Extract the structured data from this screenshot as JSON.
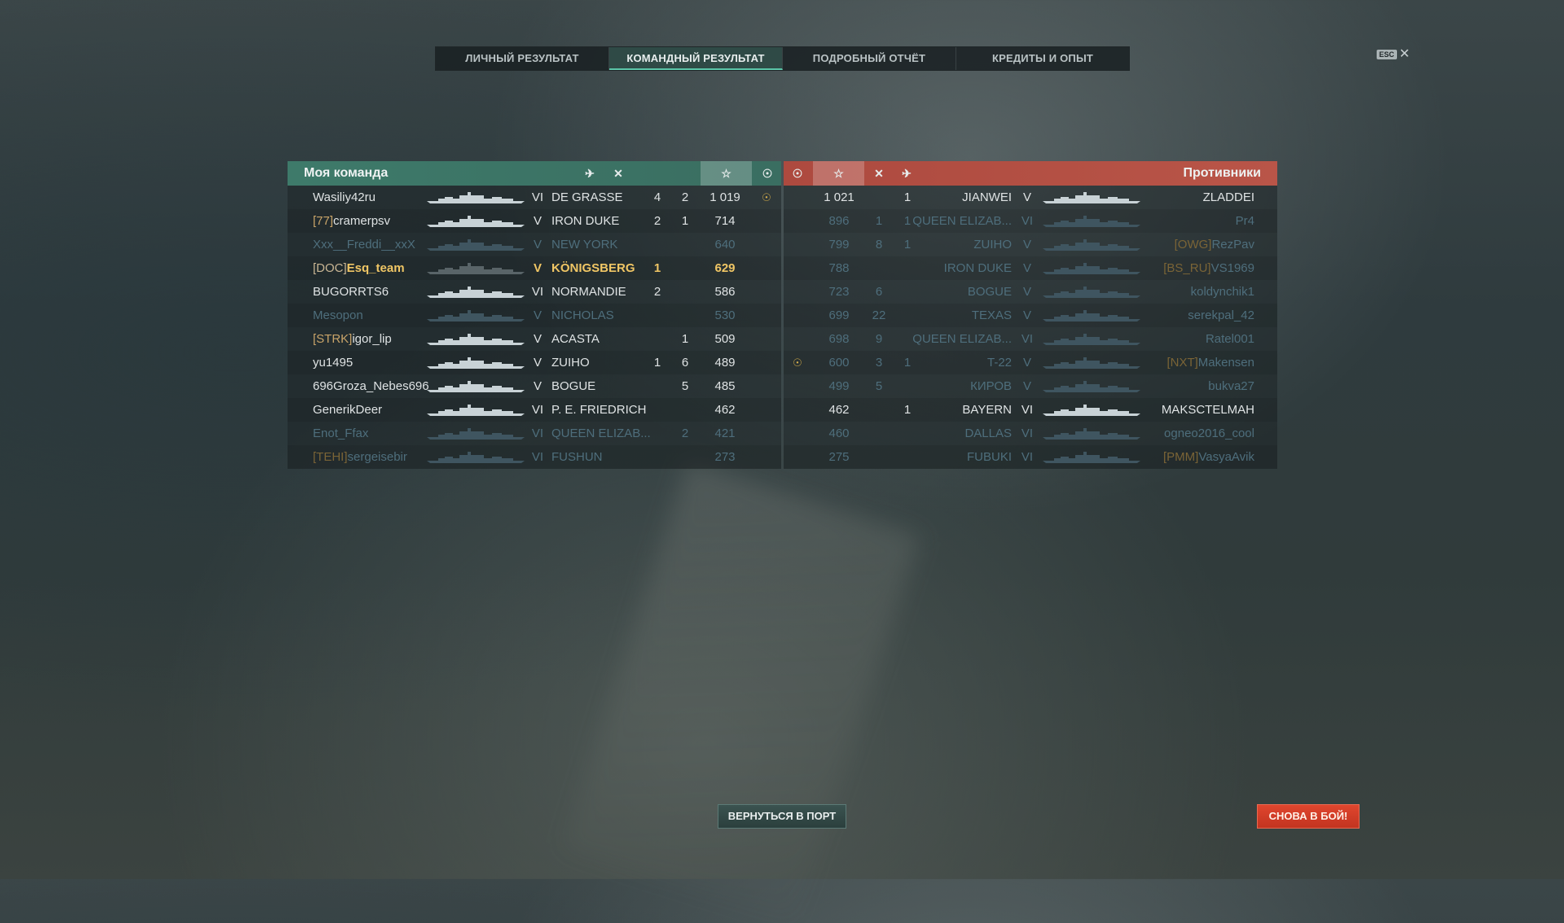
{
  "tabs": [
    "ЛИЧНЫЙ РЕЗУЛЬТАТ",
    "КОМАНДНЫЙ РЕЗУЛЬТАТ",
    "ПОДРОБНЫЙ ОТЧЁТ",
    "КРЕДИТЫ И ОПЫТ"
  ],
  "active_tab": 1,
  "esc_label": "ESC",
  "close_symbol": "✕",
  "header_icons": {
    "planes": "✈",
    "frags": "✕",
    "score": "☆",
    "base": "☉"
  },
  "my_team": {
    "title": "Моя команда",
    "rows": [
      {
        "clan": "",
        "player": "Wasiliy42ru",
        "tier": "VI",
        "ship": "DE GRASSE",
        "planes": "4",
        "frags": "2",
        "score": "1 019",
        "base": "☉",
        "status": "alive"
      },
      {
        "clan": "[77]",
        "player": "cramerpsv",
        "tier": "V",
        "ship": "IRON DUKE",
        "planes": "2",
        "frags": "1",
        "score": "714",
        "base": "",
        "status": "alive"
      },
      {
        "clan": "",
        "player": "Xxx__Freddi__xxX",
        "tier": "V",
        "ship": "NEW YORK",
        "planes": "",
        "frags": "",
        "score": "640",
        "base": "",
        "status": "dead"
      },
      {
        "clan": "[DOC]",
        "player": "Esq_team",
        "tier": "V",
        "ship": "KÖNIGSBERG",
        "planes": "1",
        "frags": "",
        "score": "629",
        "base": "",
        "status": "me"
      },
      {
        "clan": "",
        "player": "BUGORRTS6",
        "tier": "VI",
        "ship": "NORMANDIE",
        "planes": "2",
        "frags": "",
        "score": "586",
        "base": "",
        "status": "alive"
      },
      {
        "clan": "",
        "player": "Mesopon",
        "tier": "V",
        "ship": "NICHOLAS",
        "planes": "",
        "frags": "",
        "score": "530",
        "base": "",
        "status": "dead"
      },
      {
        "clan": "[STRK]",
        "player": "igor_lip",
        "tier": "V",
        "ship": "ACASTA",
        "planes": "",
        "frags": "1",
        "score": "509",
        "base": "",
        "status": "alive"
      },
      {
        "clan": "",
        "player": "yu1495",
        "tier": "V",
        "ship": "ZUIHO",
        "planes": "1",
        "frags": "6",
        "score": "489",
        "base": "",
        "status": "alive"
      },
      {
        "clan": "",
        "player": "696Groza_Nebes696",
        "tier": "V",
        "ship": "BOGUE",
        "planes": "",
        "frags": "5",
        "score": "485",
        "base": "",
        "status": "alive"
      },
      {
        "clan": "",
        "player": "GenerikDeer",
        "tier": "VI",
        "ship": "P. E. FRIEDRICH",
        "planes": "",
        "frags": "",
        "score": "462",
        "base": "",
        "status": "alive"
      },
      {
        "clan": "",
        "player": "Enot_Ffax",
        "tier": "VI",
        "ship": "QUEEN ELIZAB...",
        "planes": "",
        "frags": "2",
        "score": "421",
        "base": "",
        "status": "dead"
      },
      {
        "clan": "[TEHI]",
        "player": "sergeisebir",
        "tier": "VI",
        "ship": "FUSHUN",
        "planes": "",
        "frags": "",
        "score": "273",
        "base": "",
        "status": "dead"
      }
    ]
  },
  "enemy_team": {
    "title": "Противники",
    "rows": [
      {
        "base": "",
        "score": "1 021",
        "frags": "",
        "planes": "1",
        "ship": "JIANWEI",
        "tier": "V",
        "clan": "",
        "player": "ZLADDEI",
        "status": "alive"
      },
      {
        "base": "",
        "score": "896",
        "frags": "1",
        "planes": "1",
        "ship": "QUEEN ELIZAB...",
        "tier": "VI",
        "clan": "",
        "player": "Pr4",
        "status": "dead"
      },
      {
        "base": "",
        "score": "799",
        "frags": "8",
        "planes": "1",
        "ship": "ZUIHO",
        "tier": "V",
        "clan": "[OWG]",
        "player": "RezPav",
        "status": "dead"
      },
      {
        "base": "",
        "score": "788",
        "frags": "",
        "planes": "",
        "ship": "IRON DUKE",
        "tier": "V",
        "clan": "[BS_RU]",
        "player": "VS1969",
        "status": "dead"
      },
      {
        "base": "",
        "score": "723",
        "frags": "6",
        "planes": "",
        "ship": "BOGUE",
        "tier": "V",
        "clan": "",
        "player": "koldynchik1",
        "status": "dead"
      },
      {
        "base": "",
        "score": "699",
        "frags": "22",
        "planes": "",
        "ship": "TEXAS",
        "tier": "V",
        "clan": "",
        "player": "serekpal_42",
        "status": "dead"
      },
      {
        "base": "",
        "score": "698",
        "frags": "9",
        "planes": "",
        "ship": "QUEEN ELIZAB...",
        "tier": "VI",
        "clan": "",
        "player": "Ratel001",
        "status": "dead"
      },
      {
        "base": "☉",
        "score": "600",
        "frags": "3",
        "planes": "1",
        "ship": "T-22",
        "tier": "V",
        "clan": "[NXT]",
        "player": "Makensen",
        "status": "dead"
      },
      {
        "base": "",
        "score": "499",
        "frags": "5",
        "planes": "",
        "ship": "КИРОВ",
        "tier": "V",
        "clan": "",
        "player": "bukva27",
        "status": "dead"
      },
      {
        "base": "",
        "score": "462",
        "frags": "",
        "planes": "1",
        "ship": "BAYERN",
        "tier": "VI",
        "clan": "",
        "player": "MAKSCTELMAH",
        "status": "alive"
      },
      {
        "base": "",
        "score": "460",
        "frags": "",
        "planes": "",
        "ship": "DALLAS",
        "tier": "VI",
        "clan": "",
        "player": "ogneo2016_cool",
        "status": "dead"
      },
      {
        "base": "",
        "score": "275",
        "frags": "",
        "planes": "",
        "ship": "FUBUKI",
        "tier": "VI",
        "clan": "[PMM]",
        "player": "VasyaAvik",
        "status": "dead"
      }
    ]
  },
  "buttons": {
    "port": "ВЕРНУТЬСЯ В ПОРТ",
    "battle": "СНОВА В БОЙ!"
  }
}
